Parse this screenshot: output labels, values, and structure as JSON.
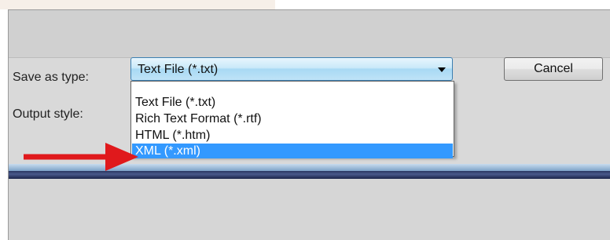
{
  "dialog": {
    "save_as_type_label": "Save as type:",
    "output_style_label": "Output style:",
    "save_as_type_value": "Text File (*.txt)",
    "cancel_label": "Cancel",
    "options": [
      {
        "label": "Text File (*.txt)",
        "selected": false
      },
      {
        "label": "Rich Text Format (*.rtf)",
        "selected": false
      },
      {
        "label": "HTML (*.htm)",
        "selected": false
      },
      {
        "label": "XML (*.xml)",
        "selected": true
      }
    ],
    "highlight_color": "#3399ff",
    "annotation_arrow_color": "#e0191c"
  }
}
